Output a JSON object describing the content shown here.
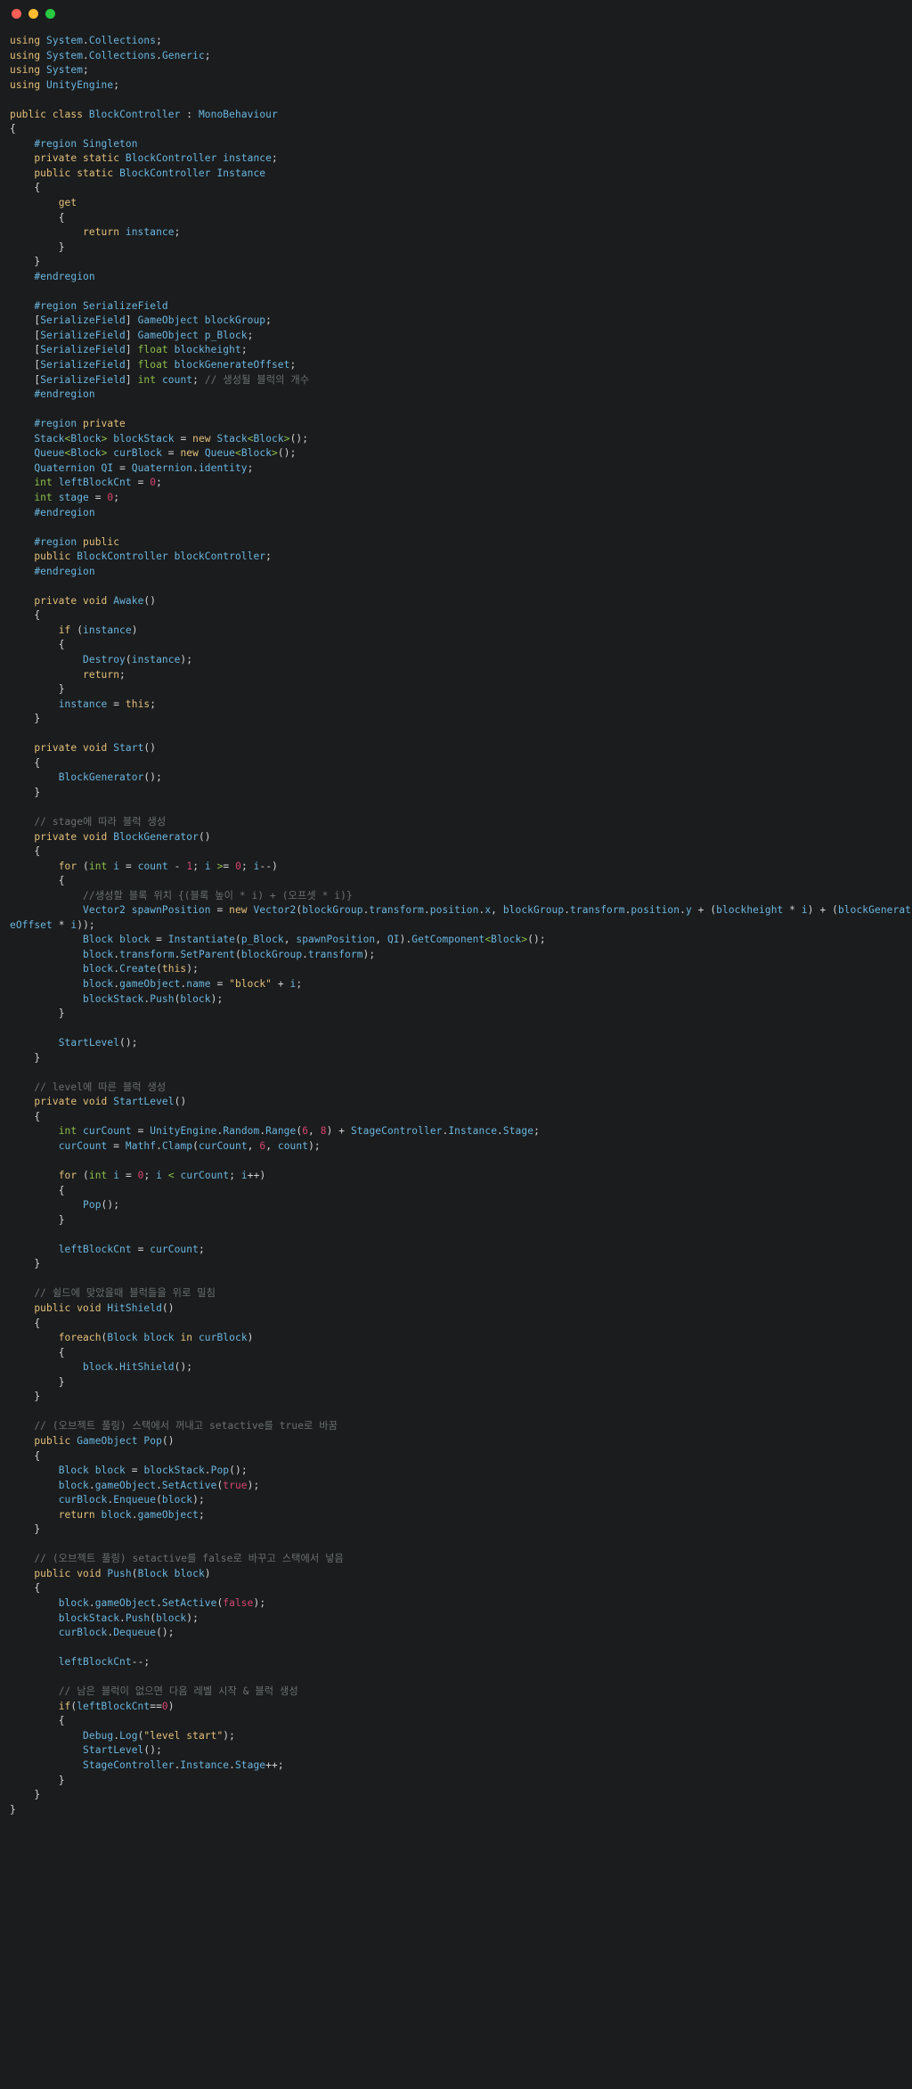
{
  "window": {
    "title": "",
    "traffic_lights": [
      "close",
      "minimize",
      "maximize"
    ]
  },
  "editor": {
    "language": "C#",
    "theme_background": "#1a1c1d",
    "colors": {
      "keyword": "#e5c07b",
      "type": "#6cb6e0",
      "comment": "#6b7170",
      "number": "#d6466f",
      "string": "#e5c07b",
      "punctuation": "#d4d4d4",
      "primitive": "#8fbf4a",
      "close_dot": "#ff5f57",
      "minimize_dot": "#febc2e",
      "maximize_dot": "#28c840"
    },
    "lines": [
      "using System.Collections;",
      "using System.Collections.Generic;",
      "using System;",
      "using UnityEngine;",
      "",
      "public class BlockController : MonoBehaviour",
      "{",
      "    #region Singleton",
      "    private static BlockController instance;",
      "    public static BlockController Instance",
      "    {",
      "        get",
      "        {",
      "            return instance;",
      "        }",
      "    }",
      "    #endregion",
      "",
      "    #region SerializeField",
      "    [SerializeField] GameObject blockGroup;",
      "    [SerializeField] GameObject p_Block;",
      "    [SerializeField] float blockheight;",
      "    [SerializeField] float blockGenerateOffset;",
      "    [SerializeField] int count; // 생성될 블럭의 개수",
      "    #endregion",
      "",
      "    #region private",
      "    Stack<Block> blockStack = new Stack<Block>();",
      "    Queue<Block> curBlock = new Queue<Block>();",
      "    Quaternion QI = Quaternion.identity;",
      "    int leftBlockCnt = 0;",
      "    int stage = 0;",
      "    #endregion",
      "",
      "    #region public",
      "    public BlockController blockController;",
      "    #endregion",
      "",
      "    private void Awake()",
      "    {",
      "        if (instance)",
      "        {",
      "            Destroy(instance);",
      "            return;",
      "        }",
      "        instance = this;",
      "    }",
      "",
      "    private void Start()",
      "    {",
      "        BlockGenerator();",
      "    }",
      "",
      "    // stage에 따라 블럭 생성",
      "    private void BlockGenerator()",
      "    {",
      "        for (int i = count - 1; i >= 0; i--)",
      "        {",
      "            //생성할 블록 위치 {(블록 높이 * i) + (오프셋 * i)}",
      "            Vector2 spawnPosition = new Vector2(blockGroup.transform.position.x, blockGroup.transform.position.y + (blockheight * i) + (blockGenerateOffset * i));",
      "            Block block = Instantiate(p_Block, spawnPosition, QI).GetComponent<Block>();",
      "            block.transform.SetParent(blockGroup.transform);",
      "            block.Create(this);",
      "            block.gameObject.name = \"block\" + i;",
      "            blockStack.Push(block);",
      "        }",
      "",
      "        StartLevel();",
      "    }",
      "",
      "    // level에 따른 블럭 생성",
      "    private void StartLevel()",
      "    {",
      "        int curCount = UnityEngine.Random.Range(6, 8) + StageController.Instance.Stage;",
      "        curCount = Mathf.Clamp(curCount, 6, count);",
      "",
      "        for (int i = 0; i < curCount; i++)",
      "        {",
      "            Pop();",
      "        }",
      "",
      "        leftBlockCnt = curCount;",
      "    }",
      "",
      "    // 쉴드에 맞았을때 블럭들을 위로 밀침",
      "    public void HitShield()",
      "    {",
      "        foreach(Block block in curBlock)",
      "        {",
      "            block.HitShield();",
      "        }",
      "    }",
      "",
      "    // (오브젝트 풀링) 스택에서 꺼내고 setactive를 true로 바꿈",
      "    public GameObject Pop()",
      "    {",
      "        Block block = blockStack.Pop();",
      "        block.gameObject.SetActive(true);",
      "        curBlock.Enqueue(block);",
      "        return block.gameObject;",
      "    }",
      "",
      "    // (오브젝트 풀링) setactive를 false로 바꾸고 스택에서 넣음",
      "    public void Push(Block block)",
      "    {",
      "        block.gameObject.SetActive(false);",
      "        blockStack.Push(block);",
      "        curBlock.Dequeue();",
      "",
      "        leftBlockCnt--;",
      "",
      "        // 남은 블럭이 없으면 다음 레벨 시작 & 블럭 생성",
      "        if(leftBlockCnt==0)",
      "        {",
      "            Debug.Log(\"level start\");",
      "            StartLevel();",
      "            StageController.Instance.Stage++;",
      "        }",
      "    }",
      "}"
    ]
  }
}
